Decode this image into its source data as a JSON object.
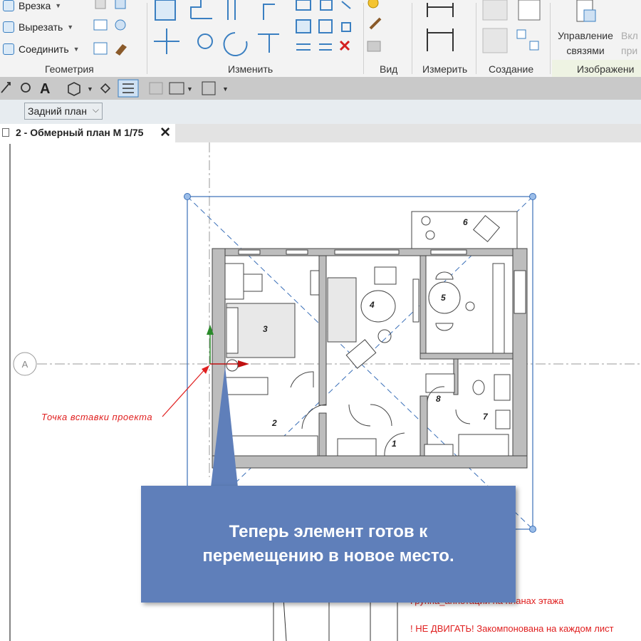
{
  "ribbon": {
    "geometry": {
      "label": "Геометрия",
      "items": [
        "Врезка",
        "Вырезать",
        "Соединить"
      ]
    },
    "modify": {
      "label": "Изменить"
    },
    "view": {
      "label": "Вид"
    },
    "measure": {
      "label": "Измерить"
    },
    "create": {
      "label": "Создание"
    },
    "manage_links": {
      "line1": "Управление",
      "line2": "связями"
    },
    "partial": {
      "line1": "Вкл",
      "line2": "при"
    },
    "images": {
      "label": "Изображени"
    }
  },
  "options_bar": {
    "view_selector": "Задний план"
  },
  "tab": {
    "title": "2 - Обмерный план М 1/75",
    "close_icon": "close-icon"
  },
  "canvas": {
    "grid_bubble": "A",
    "insertion_point_label": "Точка вставки проекта",
    "rooms": [
      "1",
      "2",
      "3",
      "4",
      "5",
      "6",
      "7",
      "8"
    ],
    "note_1": "Группа_аннотации на планах этажа",
    "note_2": "! НЕ ДВИГАТЬ! Закомпонована на каждом лист"
  },
  "callout": {
    "line1": "Теперь элемент готов к",
    "line2": "перемещению в новое место."
  },
  "colors": {
    "accent": "#3a7fc1",
    "callout": "#5f7fba",
    "warning": "#e02020"
  }
}
